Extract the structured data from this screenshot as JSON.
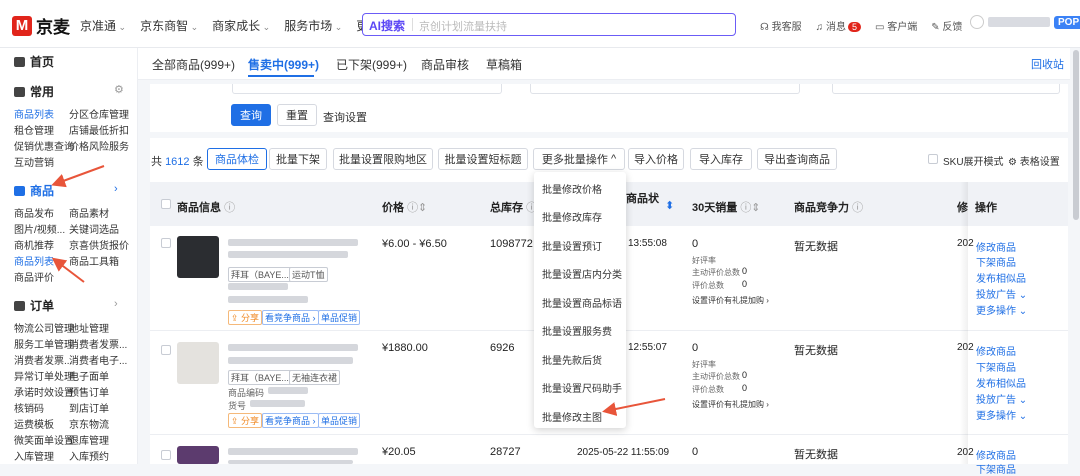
{
  "app": {
    "logo_text": "京麦"
  },
  "nav": [
    "京准通",
    "京东商智",
    "商家成长",
    "服务市场",
    "更多"
  ],
  "search": {
    "ai_label": "AI搜索",
    "placeholder": "京创计划流量扶持"
  },
  "top_right": {
    "service": "我客服",
    "message": "消息",
    "message_count": "5",
    "client": "客户端",
    "feedback": "反馈",
    "pop": "POP"
  },
  "sidebar": {
    "home": "首页",
    "common": {
      "title": "常用",
      "items": [
        "商品列表",
        "分区仓库管理",
        "租仓管理",
        "店铺最低折扣",
        "促销优惠查询",
        "价格风险服务",
        "互动营销"
      ]
    },
    "goods": {
      "title": "商品",
      "items": [
        "商品发布",
        "商品素材",
        "图片/视频...",
        "关键词选品",
        "商机推荐",
        "京喜供货报价",
        "商品列表",
        "商品工具箱",
        "商品评价"
      ]
    },
    "order": {
      "title": "订单",
      "items": [
        "物流公司管理",
        "地址管理",
        "服务工单管理",
        "消费者发票...",
        "消费者发票...",
        "消费者电子...",
        "异常订单处理",
        "电子面单",
        "承诺时效设置",
        "预售订单",
        "核销码",
        "到店订单",
        "运费模板",
        "京东物流",
        "微笑面单设置",
        "退库管理",
        "入库管理",
        "入库预约"
      ]
    }
  },
  "tabs": {
    "all": "全部商品(999+)",
    "on_sale": "售卖中(999+)",
    "off": "已下架(999+)",
    "review": "商品审核",
    "draft": "草稿箱",
    "recycle": "回收站"
  },
  "filter": {
    "query": "查询",
    "reset": "重置",
    "query_settings": "查询设置"
  },
  "toolbar": {
    "count_prefix": "共",
    "count": "1612",
    "count_suffix": "条",
    "health": "商品体检",
    "batch_off": "批量下架",
    "batch_region": "批量设置限购地区",
    "batch_title": "批量设置短标题",
    "more_batch": "更多批量操作",
    "import_price": "导入价格",
    "import_stock": "导入库存",
    "export": "导出查询商品",
    "sku_mode": "SKU展开模式",
    "table_settings": "表格设置"
  },
  "table": {
    "headers": {
      "info": "商品信息",
      "price": "价格",
      "stock": "总库存",
      "status": "商品状",
      "sales": "30天销量",
      "compete": "商品竞争力",
      "mod": "修",
      "action": "操作"
    },
    "rows": [
      {
        "tag1": "拜耳（BAYE...",
        "tag2": "运动T恤",
        "share": "分享",
        "compete_tag": "看竞争商品",
        "promo": "单品促销",
        "price": "¥6.00 - ¥6.50",
        "stock": "1098772",
        "time": "13:55:08",
        "sales": "0",
        "good_rate": "好评率",
        "active_eval": "主动评价总数",
        "active_eval_val": "0",
        "eval_total": "评价总数",
        "eval_total_val": "0",
        "eval_gift": "设置评价有礼提加购",
        "compete": "暂无数据",
        "yr": "202",
        "actions": [
          "修改商品",
          "下架商品",
          "发布相似品",
          "投放广告",
          "更多操作"
        ]
      },
      {
        "tag1": "拜耳（BAYE...",
        "tag2": "无袖连衣裙",
        "code_label": "商品编码",
        "item_label": "货号",
        "share": "分享",
        "compete_tag": "看竞争商品",
        "promo": "单品促销",
        "price": "¥1880.00",
        "stock": "6926",
        "time": "12:55:07",
        "sales": "0",
        "good_rate": "好评率",
        "active_eval": "主动评价总数",
        "active_eval_val": "0",
        "eval_total": "评价总数",
        "eval_total_val": "0",
        "eval_gift": "设置评价有礼提加购",
        "compete": "暂无数据",
        "yr": "202",
        "actions": [
          "修改商品",
          "下架商品",
          "发布相似品",
          "投放广告",
          "更多操作"
        ]
      },
      {
        "price": "¥20.05",
        "stock": "28727",
        "time": "2025-05-22 11:55:09",
        "sales": "0",
        "compete": "暂无数据",
        "yr": "202",
        "actions": [
          "修改商品",
          "下架商品"
        ]
      }
    ]
  },
  "dropdown": [
    "批量修改价格",
    "批量修改库存",
    "批量设置预订",
    "批量设置店内分类",
    "批量设置商品标语",
    "批量设置服务费",
    "批量先款后货",
    "批量设置尺码助手",
    "批量修改主图"
  ],
  "colors": {
    "accent": "#1f6fe5",
    "brand": "#e1251b",
    "ai": "#5b47f5",
    "annotation_arrow": "#e8553a"
  }
}
